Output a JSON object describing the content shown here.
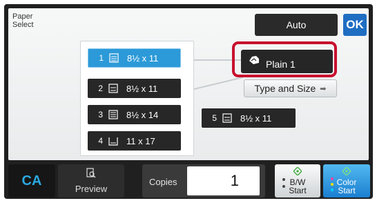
{
  "screen": {
    "title_line1": "Paper",
    "title_line2": "Select",
    "auto_label": "Auto",
    "ok_label": "OK"
  },
  "trays": [
    {
      "num": "1",
      "size": "8½ x 11",
      "selected": true
    },
    {
      "num": "2",
      "size": "8½ x 11",
      "selected": false
    },
    {
      "num": "3",
      "size": "8½ x 14",
      "selected": false
    },
    {
      "num": "4",
      "size": "11 x 17",
      "selected": false
    },
    {
      "num": "5",
      "size": "8½ x 11",
      "selected": false
    }
  ],
  "paper_type": {
    "label": "Plain 1",
    "type_size_label": "Type and Size",
    "type_size_arrow": "➡"
  },
  "bottom_bar": {
    "ca_label": "CA",
    "preview_label": "Preview",
    "copies_label": "Copies",
    "copies_value": "1",
    "bw_line1": "B/W",
    "bw_line2": "Start",
    "color_line1": "Color",
    "color_line2": "Start"
  },
  "colors": {
    "selected_tray": "#2c9ad8",
    "highlight": "#c8102e",
    "ok_button": "#1f6ec2",
    "ca_text": "#2ba8e0",
    "start_diamond": "#3aa83a"
  }
}
